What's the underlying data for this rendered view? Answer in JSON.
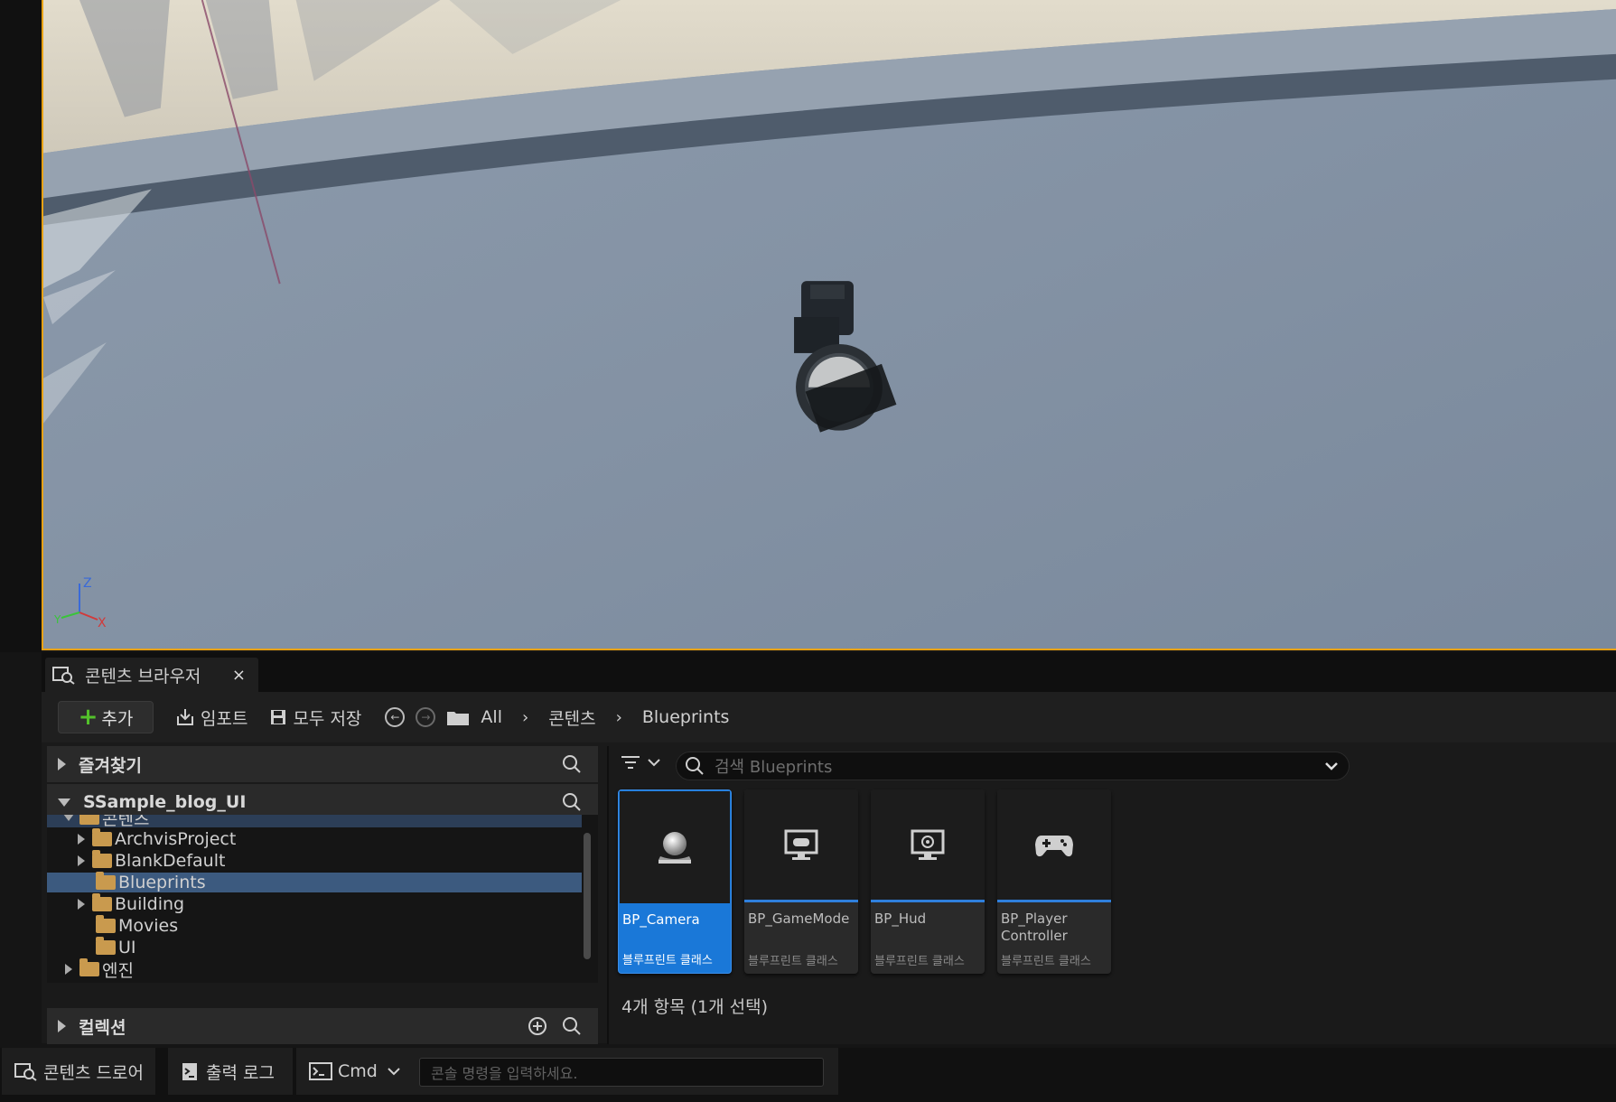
{
  "viewport": {
    "axis_labels": {
      "z": "Z",
      "y": "Y",
      "x": "X"
    }
  },
  "content_browser": {
    "tab_title": "콘텐츠 브라우저",
    "tab_close": "×",
    "toolbar": {
      "add_label": "추가",
      "import_label": "임포트",
      "save_all_label": "모두 저장",
      "breadcrumb": [
        "All",
        "콘텐츠",
        "Blueprints"
      ]
    },
    "favorites_label": "즐겨찾기",
    "project_label": "SSample_blog_UI",
    "collections_label": "컬렉션",
    "tree": [
      {
        "label": "콘텐츠",
        "expanded": true
      },
      {
        "label": "ArchvisProject",
        "expanded": false
      },
      {
        "label": "BlankDefault",
        "expanded": false
      },
      {
        "label": "Blueprints",
        "selected": true
      },
      {
        "label": "Building",
        "expanded": false
      },
      {
        "label": "Movies"
      },
      {
        "label": "UI"
      },
      {
        "label": "엔진",
        "expanded": false
      }
    ],
    "search_placeholder": "검색 Blueprints",
    "assets": [
      {
        "name": "BP_Camera",
        "type": "블루프린트 클래스",
        "icon": "camera-sphere-icon",
        "selected": true
      },
      {
        "name": "BP_GameMode",
        "type": "블루프린트 클래스",
        "icon": "monitor-gamepad-icon"
      },
      {
        "name": "BP_Hud",
        "type": "블루프린트 클래스",
        "icon": "monitor-target-icon"
      },
      {
        "name": "BP_Player Controller",
        "name_line1": "BP_Player",
        "name_line2": "Controller",
        "type": "블루프린트 클래스",
        "icon": "gamepad-icon"
      }
    ],
    "item_count": "4개 항목 (1개 선택)"
  },
  "bottom_bar": {
    "content_drawer": "콘텐츠 드로어",
    "output_log": "출력 로그",
    "cmd_label": "Cmd",
    "cmd_placeholder": "콘솔 명령을 입력하세요."
  },
  "colors": {
    "accent_selected": "#1a78d8",
    "blueprint_bar": "#2f7fdc",
    "viewport_border": "#e8a215",
    "add_plus": "#53c22b",
    "folder": "#c99a4e"
  }
}
